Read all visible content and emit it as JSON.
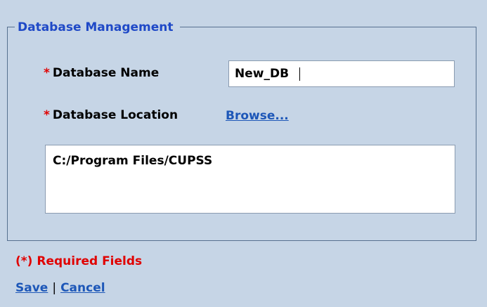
{
  "panel": {
    "legend": "Database Management"
  },
  "form": {
    "required_marker": "*",
    "name_label": "Database Name",
    "name_value": "New_DB",
    "location_label": "Database Location",
    "browse_link": "Browse...",
    "location_value": "C:/Program Files/CUPSS"
  },
  "footer": {
    "required_note": "(*) Required Fields",
    "save_link": "Save",
    "separator": "|",
    "cancel_link": "Cancel"
  },
  "colors": {
    "background": "#c6d5e6",
    "legend": "#1f49c7",
    "link": "#1d57b8",
    "required": "#e00000"
  }
}
